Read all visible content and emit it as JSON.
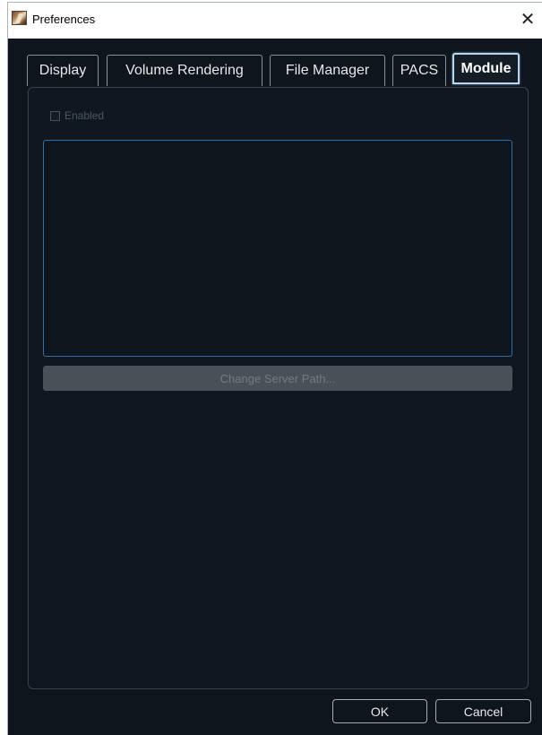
{
  "window": {
    "title": "Preferences",
    "close_glyph": "✕",
    "app_icon": "app-logo-icon"
  },
  "tabs": [
    {
      "label": "Display",
      "active": false
    },
    {
      "label": "Volume Rendering",
      "active": false
    },
    {
      "label": "File Manager",
      "active": false
    },
    {
      "label": "PACS",
      "active": false
    },
    {
      "label": "Module",
      "active": true
    }
  ],
  "module": {
    "enabled_label": "Enabled",
    "enabled_checked": false,
    "change_server_path_label": "Change Server Path..."
  },
  "footer": {
    "ok_label": "OK",
    "cancel_label": "Cancel"
  },
  "colors": {
    "background": "#0f151c",
    "active_tab_border": "#b8d6ee",
    "list_border": "#2e6fa5"
  }
}
